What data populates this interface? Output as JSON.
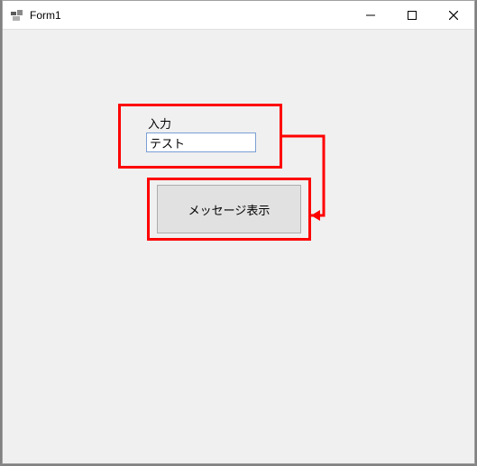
{
  "window": {
    "title": "Form1"
  },
  "form": {
    "input_label": "入力",
    "input_value": "テスト",
    "button_label": "メッセージ表示"
  },
  "annotation_color": "#ff0000"
}
